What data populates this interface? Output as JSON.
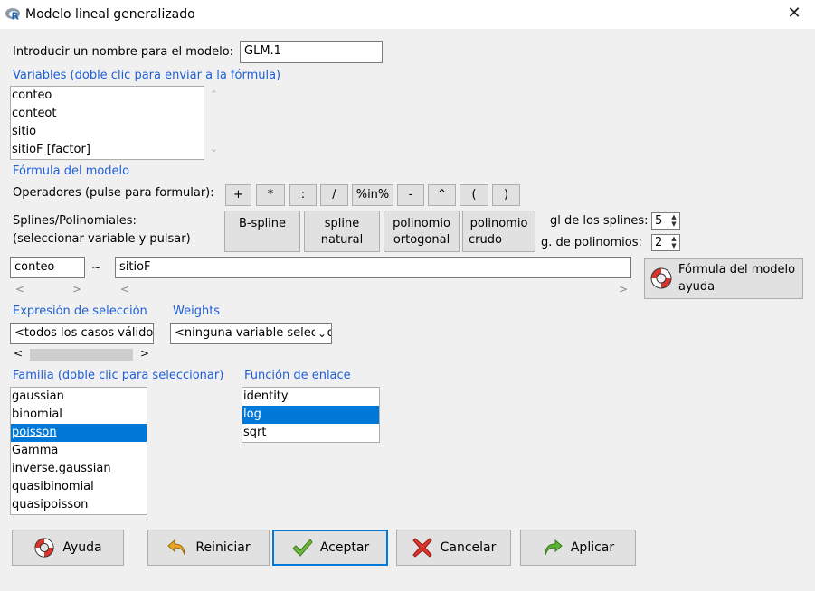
{
  "window": {
    "title": "Modelo lineal generalizado",
    "logo_icon": "r-logo-icon",
    "close_icon": "close-icon"
  },
  "model_name": {
    "label": "Introducir un nombre para el modelo:",
    "value": "GLM.1"
  },
  "variables": {
    "label": "Variables (doble clic para enviar a la fórmula)",
    "items": [
      "conteo",
      "conteot",
      "sitio",
      "sitioF [factor]"
    ]
  },
  "formula": {
    "section_label": "Fórmula del modelo",
    "operators_label": "Operadores (pulse para formular):",
    "operators": [
      "+",
      "*",
      ":",
      "/",
      "%in%",
      "-",
      "^",
      "(",
      ")"
    ],
    "splines_label_1": "Splines/Polinomiales:",
    "splines_label_2": "(seleccionar variable y pulsar)",
    "bspline": "B-spline",
    "spline_natural_1": "spline",
    "spline_natural_2": "natural",
    "poly_orth_1": "polinomio",
    "poly_orth_2": "ortogonal",
    "poly_raw_1": "polinomio",
    "poly_raw_2": "crudo",
    "gl_splines_label": "gl de los splines:",
    "gl_splines_value": "5",
    "g_poly_label": "g. de polinomios:",
    "g_poly_value": "2",
    "lhs": "conteo",
    "tilde": "~",
    "rhs": "sitioF",
    "help_line1": "Fórmula del modelo",
    "help_line2": "ayuda"
  },
  "subset": {
    "label": "Expresión de selección",
    "value": "<todos los casos válidos>"
  },
  "weights": {
    "label": "Weights",
    "value": "<ninguna variable seleccionada>"
  },
  "family": {
    "label": "Familia (doble clic para seleccionar)",
    "items": [
      "gaussian",
      "binomial",
      "poisson",
      "Gamma",
      "inverse.gaussian",
      "quasibinomial",
      "quasipoisson"
    ],
    "selected": "poisson"
  },
  "link": {
    "label": "Función de enlace",
    "items": [
      "identity",
      "log",
      "sqrt"
    ],
    "selected": "log"
  },
  "buttons": {
    "help": "Ayuda",
    "reset": "Reiniciar",
    "ok": "Aceptar",
    "cancel": "Cancelar",
    "apply": "Aplicar"
  },
  "colors": {
    "accent": "#0078d7",
    "label_blue": "#1f5fd6"
  }
}
